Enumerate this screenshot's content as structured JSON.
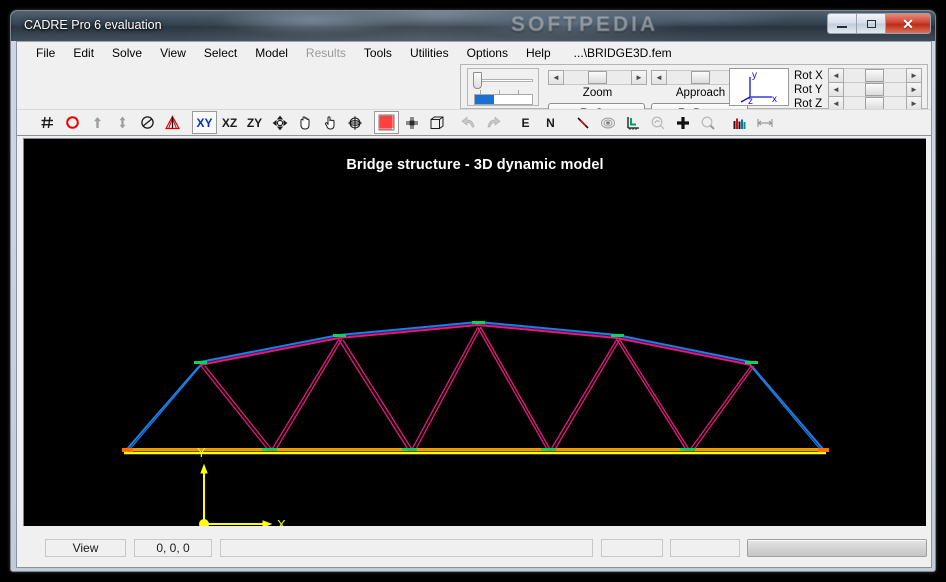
{
  "window": {
    "title": "CADRE Pro 6 evaluation",
    "watermark": "SOFTPEDIA",
    "buttons": {
      "minimize": "minimize-button",
      "maximize": "maximize-button",
      "close": "✕"
    }
  },
  "menu": {
    "items": [
      {
        "label": "File",
        "disabled": false
      },
      {
        "label": "Edit",
        "disabled": false
      },
      {
        "label": "Solve",
        "disabled": false
      },
      {
        "label": "View",
        "disabled": false
      },
      {
        "label": "Select",
        "disabled": false
      },
      {
        "label": "Model",
        "disabled": false
      },
      {
        "label": "Results",
        "disabled": true
      },
      {
        "label": "Tools",
        "disabled": false
      },
      {
        "label": "Utilities",
        "disabled": false
      },
      {
        "label": "Options",
        "disabled": false
      },
      {
        "label": "Help",
        "disabled": false
      }
    ],
    "file_path": "...\\BRIDGE3D.fem"
  },
  "control_panel": {
    "zoom_label": "Zoom",
    "approach_label": "Approach",
    "reset_button": "ReSet",
    "redraw_button": "ReDraw",
    "arrow_left": "◄",
    "arrow_right": "►",
    "axis_preview": {
      "y": "y",
      "z": "z",
      "x": "x"
    },
    "rotation": [
      {
        "label": "Rot X"
      },
      {
        "label": "Rot Y"
      },
      {
        "label": "Rot Z"
      }
    ]
  },
  "toolbar": {
    "items": [
      {
        "name": "grid-hash-icon",
        "kind": "icon",
        "pressed": false
      },
      {
        "name": "node-circle-icon",
        "kind": "icon",
        "pressed": false
      },
      {
        "name": "arrow-up-icon",
        "kind": "icon",
        "pressed": false
      },
      {
        "name": "arrow-updown-icon",
        "kind": "icon",
        "pressed": false
      },
      {
        "name": "no-entry-icon",
        "kind": "icon",
        "pressed": false
      },
      {
        "name": "warning-triangle-icon",
        "kind": "icon",
        "pressed": false
      },
      {
        "name": "view-xy-button",
        "kind": "text",
        "label": "XY",
        "pressed": true,
        "accent": true
      },
      {
        "name": "view-xz-button",
        "kind": "text",
        "label": "XZ",
        "pressed": false
      },
      {
        "name": "view-zy-button",
        "kind": "text",
        "label": "ZY",
        "pressed": false
      },
      {
        "name": "move-icon",
        "kind": "icon",
        "pressed": false
      },
      {
        "name": "pan-hand-icon",
        "kind": "icon",
        "pressed": false
      },
      {
        "name": "pointer-hand-icon",
        "kind": "icon",
        "pressed": false
      },
      {
        "name": "rotate-target-icon",
        "kind": "icon",
        "pressed": false
      },
      {
        "name": "grid-mesh-icon",
        "kind": "icon",
        "pressed": true
      },
      {
        "name": "node-marker-icon",
        "kind": "icon",
        "pressed": false
      },
      {
        "name": "cube-icon",
        "kind": "icon",
        "pressed": false
      },
      {
        "name": "undo-icon",
        "kind": "icon",
        "pressed": false
      },
      {
        "name": "redo-icon",
        "kind": "icon",
        "pressed": false
      },
      {
        "name": "element-label-e-button",
        "kind": "text",
        "label": "E",
        "pressed": false
      },
      {
        "name": "node-label-n-button",
        "kind": "text",
        "label": "N",
        "pressed": false
      },
      {
        "name": "line-element-icon",
        "kind": "icon",
        "pressed": false
      },
      {
        "name": "shell-element-icon",
        "kind": "icon",
        "pressed": false
      },
      {
        "name": "axis-local-icon",
        "kind": "icon",
        "pressed": false
      },
      {
        "name": "zoom-out-icon",
        "kind": "icon",
        "pressed": false
      },
      {
        "name": "add-plus-icon",
        "kind": "icon",
        "pressed": false
      },
      {
        "name": "zoom-in-icon",
        "kind": "icon",
        "pressed": false
      },
      {
        "name": "bar-chart-icon",
        "kind": "icon",
        "pressed": false
      },
      {
        "name": "measure-span-icon",
        "kind": "icon",
        "pressed": false
      }
    ]
  },
  "viewport": {
    "title": "Bridge structure - 3D dynamic model",
    "background": "#000000",
    "axis_indicator": {
      "y_label": "Y",
      "x_label": "X",
      "color": "#ffff00"
    },
    "model_colors": {
      "top_chord_blue": "#1f7fe8",
      "web_magenta": "#e6187e",
      "end_post_blue": "#1f7fe8",
      "bottom_chord_yellow": "#ffff00",
      "bottom_chord_orange": "#ff9000",
      "node_green": "#00d860"
    }
  },
  "status_bar": {
    "mode": "View",
    "coordinates": "0, 0, 0",
    "message": "",
    "field_a": "",
    "field_b": ""
  }
}
